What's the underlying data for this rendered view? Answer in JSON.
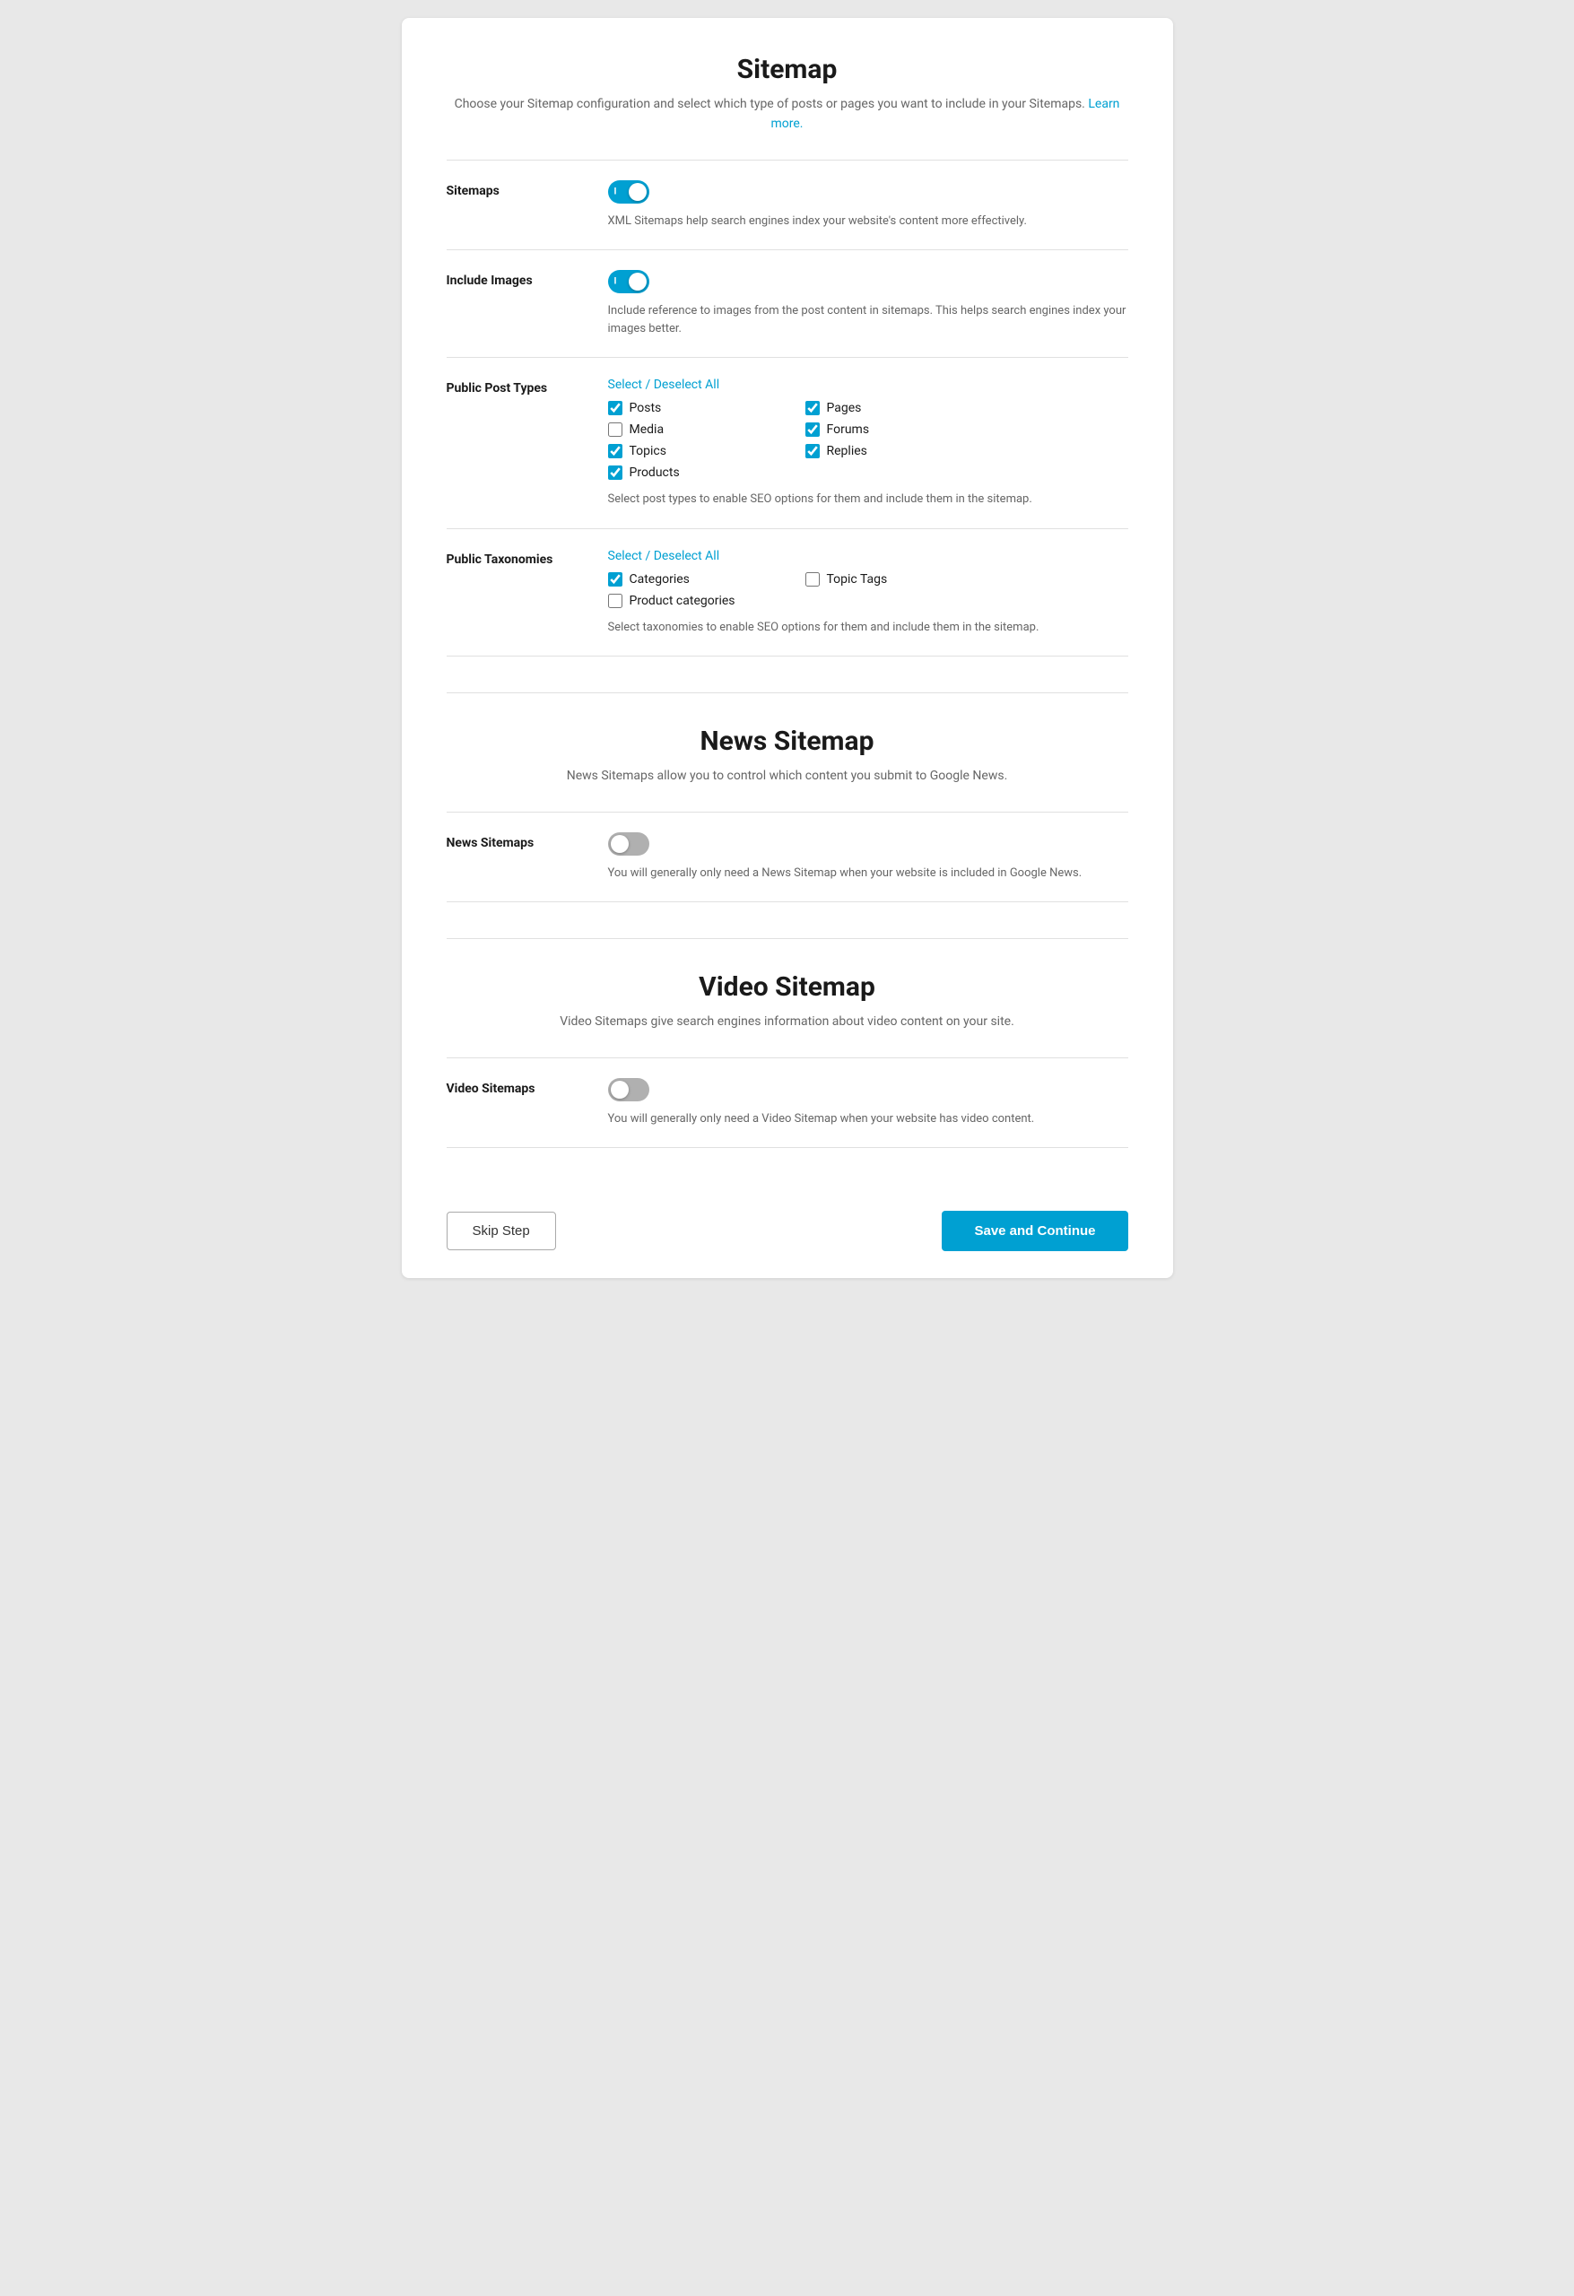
{
  "sitemap_section": {
    "title": "Sitemap",
    "description": "Choose your Sitemap configuration and select which type of posts or pages you want to include in your Sitemaps.",
    "learn_more_label": "Learn more.",
    "learn_more_url": "#"
  },
  "sitemaps_row": {
    "label": "Sitemaps",
    "toggle_state": "on",
    "description": "XML Sitemaps help search engines index your website's content more effectively."
  },
  "include_images_row": {
    "label": "Include Images",
    "toggle_state": "on",
    "description": "Include reference to images from the post content in sitemaps. This helps search engines index your images better."
  },
  "public_post_types_row": {
    "label": "Public Post Types",
    "select_all_label": "Select / Deselect All",
    "items": [
      {
        "label": "Posts",
        "checked": true,
        "col": 0
      },
      {
        "label": "Pages",
        "checked": true,
        "col": 1
      },
      {
        "label": "Media",
        "checked": false,
        "col": 0
      },
      {
        "label": "Forums",
        "checked": true,
        "col": 1
      },
      {
        "label": "Topics",
        "checked": true,
        "col": 0
      },
      {
        "label": "Replies",
        "checked": true,
        "col": 1
      },
      {
        "label": "Products",
        "checked": true,
        "col": 0
      }
    ],
    "description": "Select post types to enable SEO options for them and include them in the sitemap."
  },
  "public_taxonomies_row": {
    "label": "Public Taxonomies",
    "select_all_label": "Select / Deselect All",
    "items": [
      {
        "label": "Categories",
        "checked": true,
        "col": 0
      },
      {
        "label": "Topic Tags",
        "checked": false,
        "col": 1
      },
      {
        "label": "Product categories",
        "checked": false,
        "col": 0
      }
    ],
    "description": "Select taxonomies to enable SEO options for them and include them in the sitemap."
  },
  "news_sitemap_section": {
    "title": "News Sitemap",
    "description": "News Sitemaps allow you to control which content you submit to Google News."
  },
  "news_sitemaps_row": {
    "label": "News Sitemaps",
    "toggle_state": "off",
    "description": "You will generally only need a News Sitemap when your website is included in Google News."
  },
  "video_sitemap_section": {
    "title": "Video Sitemap",
    "description": "Video Sitemaps give search engines information about video content on your site."
  },
  "video_sitemaps_row": {
    "label": "Video Sitemaps",
    "toggle_state": "off",
    "description": "You will generally only need a Video Sitemap when your website has video content."
  },
  "footer": {
    "skip_label": "Skip Step",
    "save_label": "Save and Continue"
  }
}
